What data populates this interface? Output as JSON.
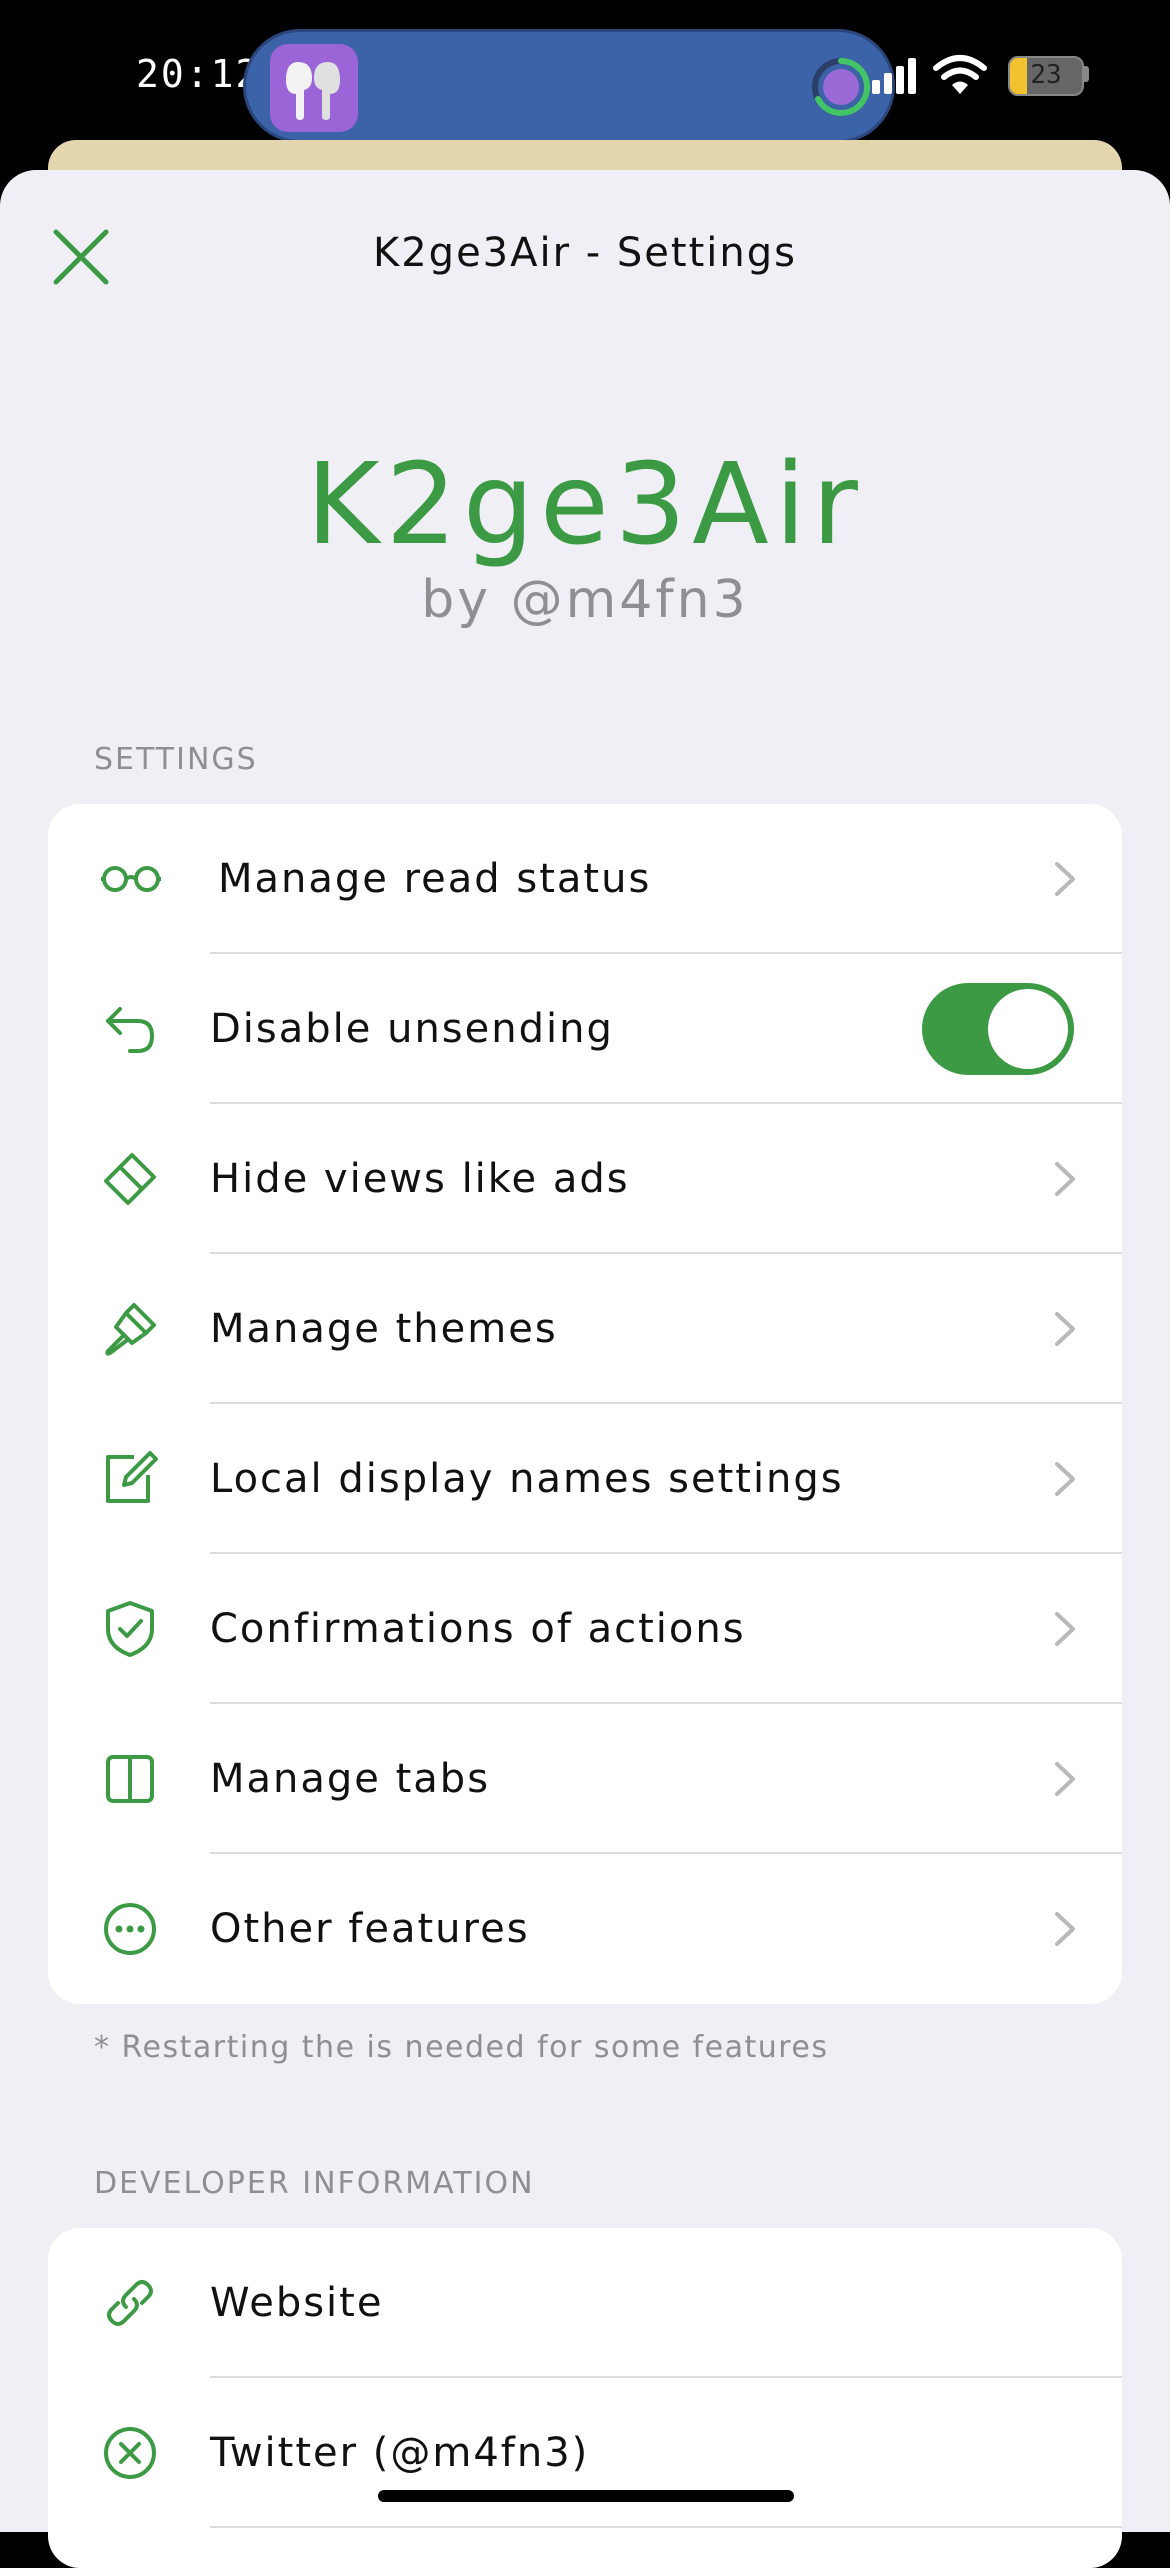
{
  "status_bar": {
    "time": "20:12",
    "battery": "23"
  },
  "colors": {
    "accent": "#3d9a44",
    "background": "#f0eff5",
    "secondary_text": "#8e8e93"
  },
  "nav": {
    "title": "K2ge3Air - Settings",
    "close_icon": "close-icon"
  },
  "header": {
    "app_name": "K2ge3Air",
    "byline": "by @m4fn3"
  },
  "settings_section": {
    "header": "SETTINGS",
    "items": [
      {
        "label": "Manage read status",
        "icon": "glasses-icon",
        "accessory": "chevron"
      },
      {
        "label": "Disable unsending",
        "icon": "undo-arrow-icon",
        "accessory": "toggle",
        "toggle_on": true
      },
      {
        "label": "Hide views like ads",
        "icon": "eraser-icon",
        "accessory": "chevron"
      },
      {
        "label": "Manage themes",
        "icon": "paintbrush-icon",
        "accessory": "chevron"
      },
      {
        "label": "Local display names settings",
        "icon": "edit-icon",
        "accessory": "chevron"
      },
      {
        "label": "Confirmations of actions",
        "icon": "shield-check-icon",
        "accessory": "chevron"
      },
      {
        "label": "Manage tabs",
        "icon": "split-panel-icon",
        "accessory": "chevron"
      },
      {
        "label": "Other features",
        "icon": "ellipsis-circle-icon",
        "accessory": "chevron"
      }
    ],
    "footnote": "* Restarting the is needed for some features"
  },
  "developer_section": {
    "header": "DEVELOPER INFORMATION",
    "items": [
      {
        "label": "Website",
        "icon": "link-icon"
      },
      {
        "label": "Twitter (@m4fn3)",
        "icon": "x-circle-icon"
      }
    ]
  }
}
